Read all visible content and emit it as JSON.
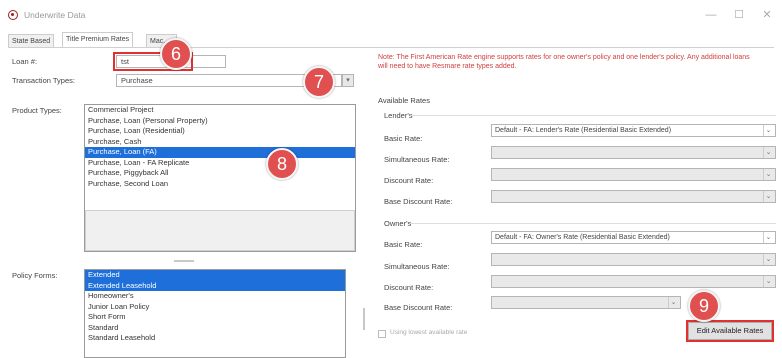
{
  "window": {
    "title": "Underwrite Data",
    "minimize": "—",
    "maximize": "☐",
    "close": "✕"
  },
  "tabs": [
    "State Based",
    "Title Premium Rates",
    "Mac...e"
  ],
  "loan": {
    "label": "Loan #:",
    "value": "tst"
  },
  "transaction": {
    "label": "Transaction Types:",
    "value": "Purchase",
    "arrow": "▾"
  },
  "product_types": {
    "label": "Product Types:",
    "items": [
      "Commercial Project",
      "Purchase, Loan (Personal Property)",
      "Purchase, Loan (Residential)",
      "Purchase, Cash",
      "Purchase, Loan (FA)",
      "Purchase, Loan - FA Replicate",
      "Purchase, Piggyback All",
      "Purchase, Second Loan"
    ],
    "selected_index": 4
  },
  "policy_forms": {
    "label": "Policy Forms:",
    "items": [
      "Extended",
      "Extended Leasehold",
      "Homeowner's",
      "Junior Loan Policy",
      "Short Form",
      "Standard",
      "Standard Leasehold"
    ],
    "selected_indices": [
      0,
      1
    ]
  },
  "note": "Note: The First American Rate engine supports rates for one owner's policy and one lender's policy. Any additional loans will need to have Resmare rate types added.",
  "available_rates": {
    "title": "Available Rates",
    "lenders": {
      "title": "Lender's",
      "basic_label": "Basic Rate:",
      "basic_value": "Default - FA: Lender's Rate (Residential Basic Extended)",
      "simultaneous_label": "Simultaneous Rate:",
      "discount_label": "Discount Rate:",
      "base_discount_label": "Base Discount Rate:"
    },
    "owners": {
      "title": "Owner's",
      "basic_label": "Basic Rate:",
      "basic_value": "Default - FA: Owner's Rate (Residential Basic Extended)",
      "simultaneous_label": "Simultaneous Rate:",
      "discount_label": "Discount Rate:",
      "base_discount_label": "Base Discount Rate:"
    },
    "dropdown_arrow": "⌄"
  },
  "checkbox_label": "Using lowest available rate",
  "edit_button": "Edit Available Rates",
  "callouts": [
    "6",
    "7",
    "8",
    "9"
  ]
}
